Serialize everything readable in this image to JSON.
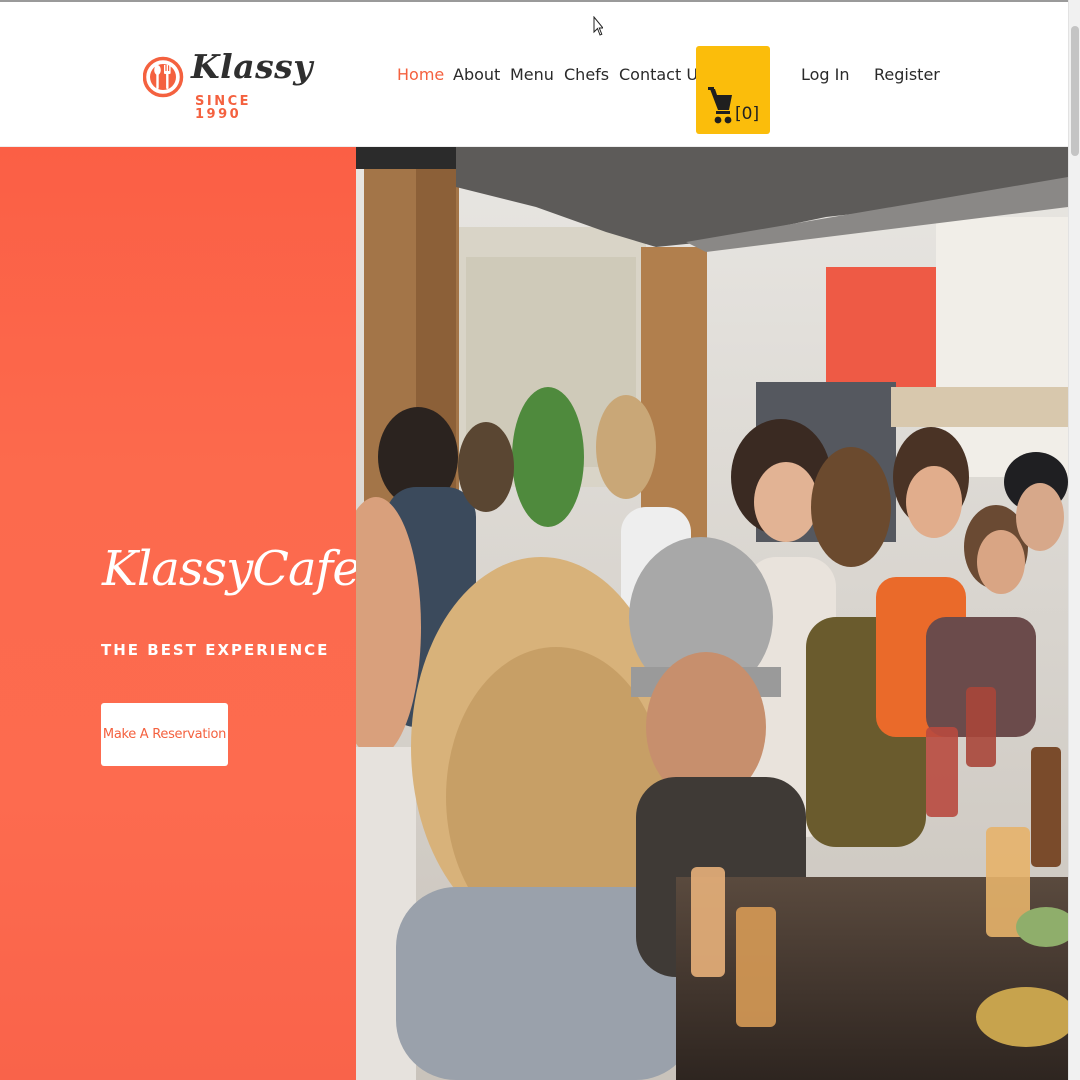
{
  "brand": {
    "name": "Klassy",
    "tagline": "SINCE 1990",
    "accent_color": "#f4613f",
    "logo_icon": "fork-spoon-plate-icon"
  },
  "nav": {
    "items": [
      {
        "label": "Home",
        "active": true
      },
      {
        "label": "About",
        "active": false
      },
      {
        "label": "Menu",
        "active": false
      },
      {
        "label": "Chefs",
        "active": false
      },
      {
        "label": "Contact Us",
        "active": false
      }
    ],
    "cart": {
      "icon": "shopping-cart-icon",
      "count_label": "[0]",
      "color": "#fbbd0b"
    },
    "login_label": "Log In",
    "register_label": "Register"
  },
  "hero": {
    "title": "KlassyCafe",
    "subtitle": "THE BEST EXPERIENCE",
    "cta_label": "Make A Reservation",
    "panel_color": "#fc6a4d",
    "photo": "people-dining-at-outdoor-restaurant-table"
  }
}
